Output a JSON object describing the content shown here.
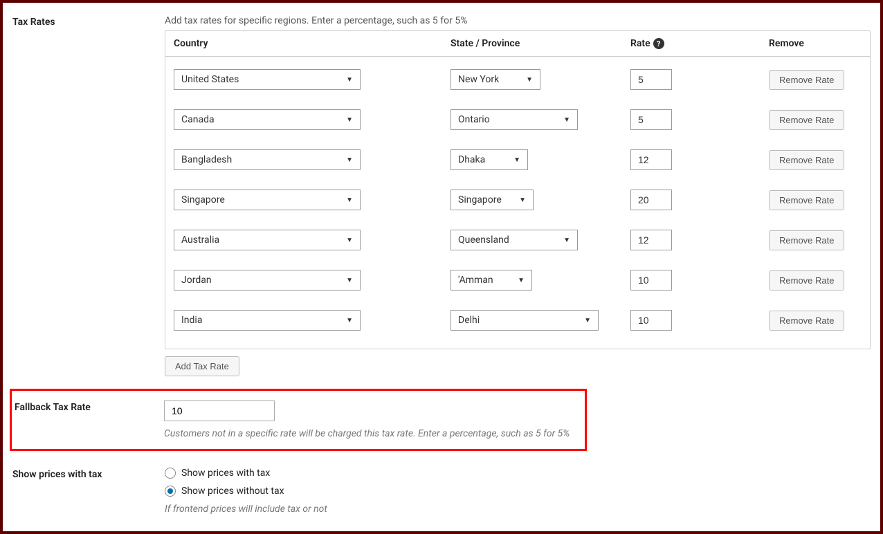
{
  "taxRates": {
    "label": "Tax Rates",
    "description": "Add tax rates for specific regions. Enter a percentage, such as 5 for 5%",
    "headers": {
      "country": "Country",
      "state": "State / Province",
      "rate": "Rate",
      "remove": "Remove"
    },
    "rows": [
      {
        "country": "United States",
        "state": "New York",
        "stateWidth": "130px",
        "rate": "5"
      },
      {
        "country": "Canada",
        "state": "Ontario",
        "stateWidth": "184px",
        "rate": "5"
      },
      {
        "country": "Bangladesh",
        "state": "Dhaka",
        "stateWidth": "112px",
        "rate": "12"
      },
      {
        "country": "Singapore",
        "state": "Singapore",
        "stateWidth": "120px",
        "rate": "20"
      },
      {
        "country": "Australia",
        "state": "Queensland",
        "stateWidth": "184px",
        "rate": "12"
      },
      {
        "country": "Jordan",
        "state": "'Amman",
        "stateWidth": "118px",
        "rate": "10"
      },
      {
        "country": "India",
        "state": "Delhi",
        "stateWidth": "214px",
        "rate": "10"
      }
    ],
    "removeLabel": "Remove Rate",
    "addLabel": "Add Tax Rate"
  },
  "fallback": {
    "label": "Fallback Tax Rate",
    "value": "10",
    "help": "Customers not in a specific rate will be charged this tax rate. Enter a percentage, such as 5 for 5%"
  },
  "showPrices": {
    "label": "Show prices with tax",
    "options": {
      "with": "Show prices with tax",
      "without": "Show prices without tax"
    },
    "selected": "without",
    "help": "If frontend prices will include tax or not"
  }
}
